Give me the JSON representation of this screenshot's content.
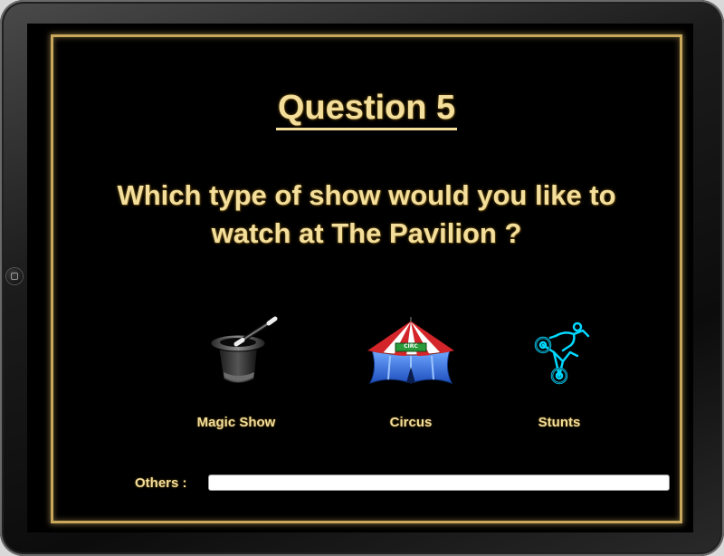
{
  "quiz": {
    "title": "Question 5",
    "question": "Which type of show would you like to watch at The Pavilion ?",
    "options": [
      {
        "label": "Magic Show",
        "icon": "magic-hat-icon"
      },
      {
        "label": "Circus",
        "icon": "circus-tent-icon",
        "sign_text": "CIRC"
      },
      {
        "label": "Stunts",
        "icon": "stunt-bike-icon"
      }
    ],
    "others_label": "Others :",
    "others_value": ""
  },
  "colors": {
    "accent": "#f3de9b",
    "frame": "#c9a85c",
    "background": "#000000"
  }
}
